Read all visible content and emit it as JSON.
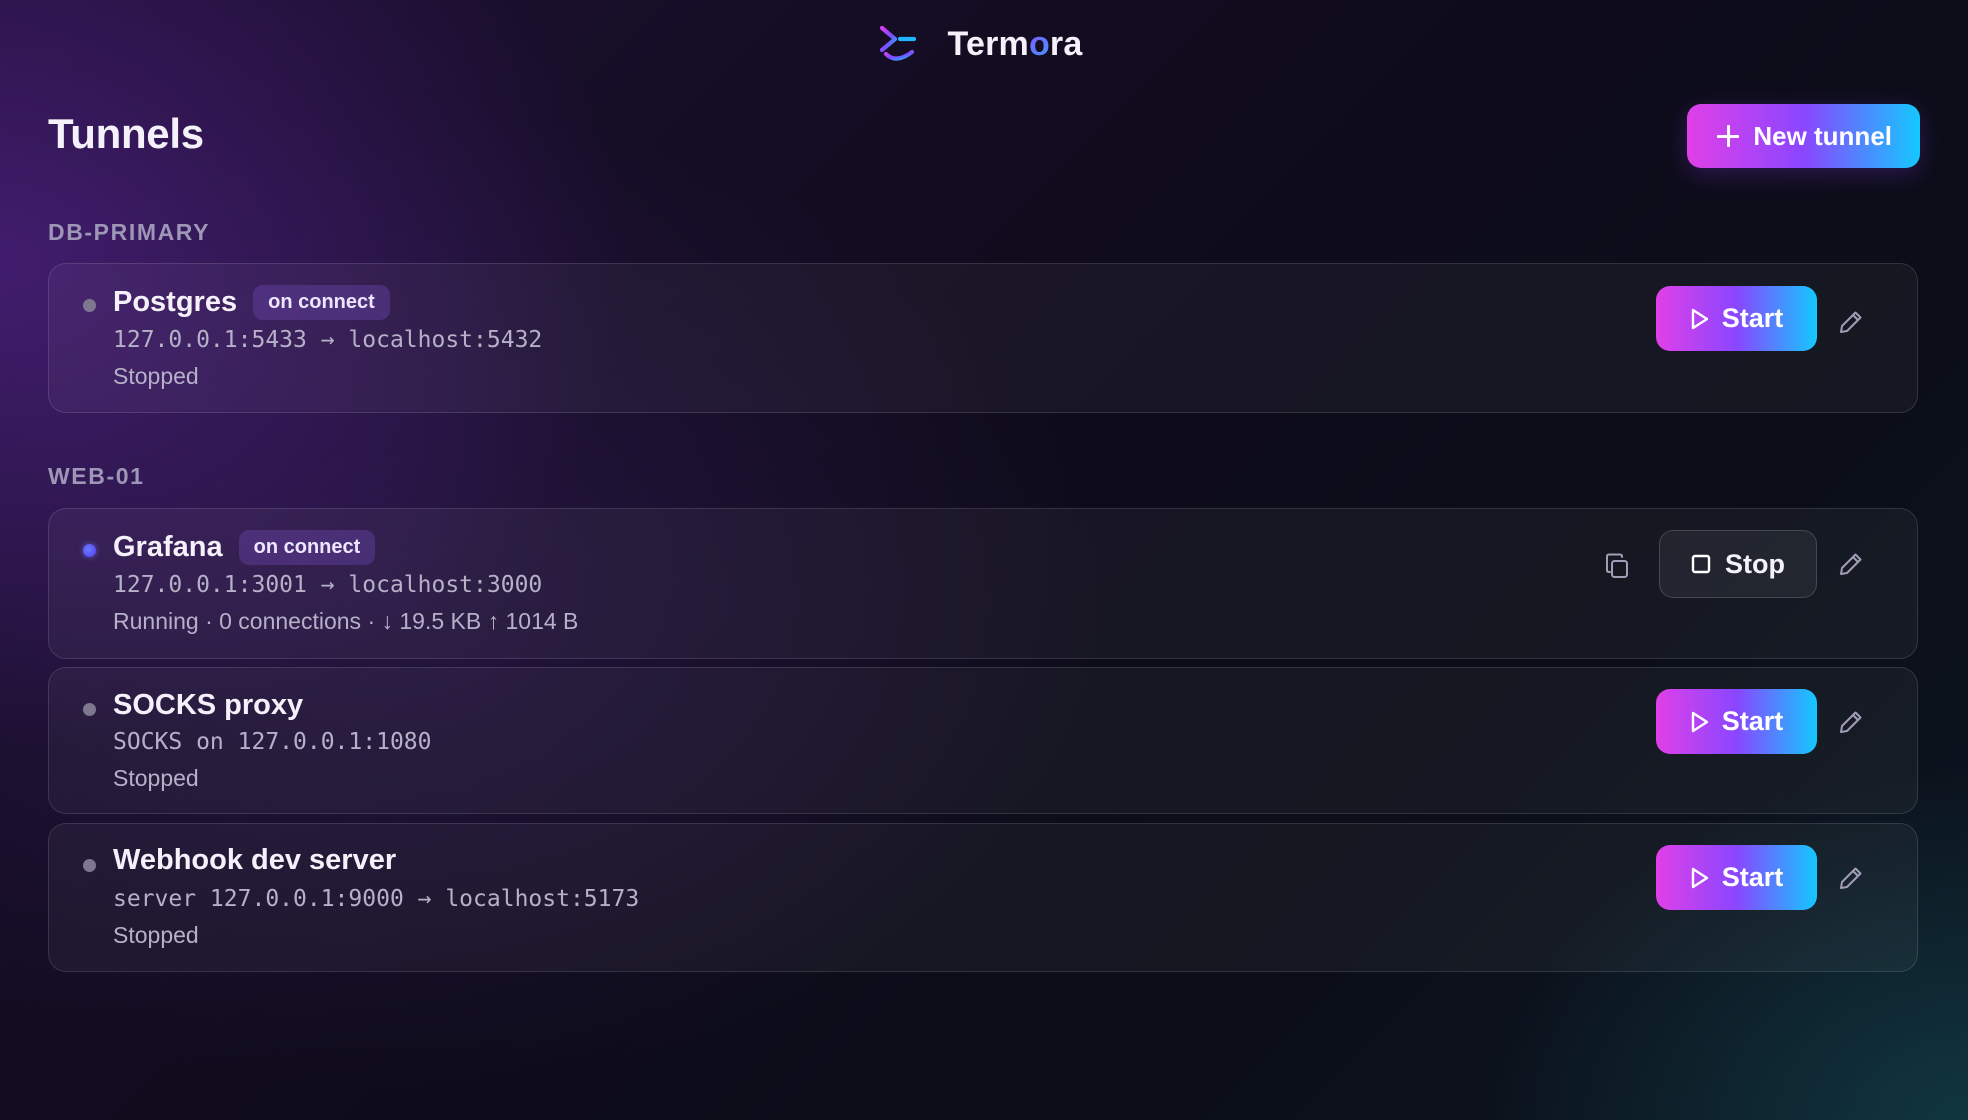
{
  "app": {
    "name_prefix": "Term",
    "name_highlight": "o",
    "name_suffix": "ra",
    "logo_icon": "termora-logo-icon"
  },
  "header": {
    "title": "Tunnels",
    "new_button_label": "New tunnel",
    "new_button_icon": "plus-icon"
  },
  "colors": {
    "accent_gradient": [
      "#e040e8",
      "#8a46ff",
      "#14c8ff"
    ],
    "stopped_dot": "#7d7890",
    "running_dot": "#5a4cf5"
  },
  "groups": [
    {
      "label": "DB-PRIMARY",
      "tunnels": [
        {
          "name": "Postgres",
          "badge": "on connect",
          "route": "127.0.0.1:5433 → localhost:5432",
          "status": "Stopped",
          "state": "stopped",
          "action_label": "Start"
        }
      ]
    },
    {
      "label": "WEB-01",
      "tunnels": [
        {
          "name": "Grafana",
          "badge": "on connect",
          "route": "127.0.0.1:3001 → localhost:3000",
          "status": "Running · 0 connections · ↓ 19.5 KB ↑ 1014 B",
          "state": "running",
          "action_label": "Stop"
        },
        {
          "name": "SOCKS proxy",
          "route": "SOCKS on 127.0.0.1:1080",
          "status": "Stopped",
          "state": "stopped",
          "action_label": "Start"
        },
        {
          "name": "Webhook dev server",
          "route": "server 127.0.0.1:9000 → localhost:5173",
          "status": "Stopped",
          "state": "stopped",
          "action_label": "Start"
        }
      ]
    }
  ]
}
